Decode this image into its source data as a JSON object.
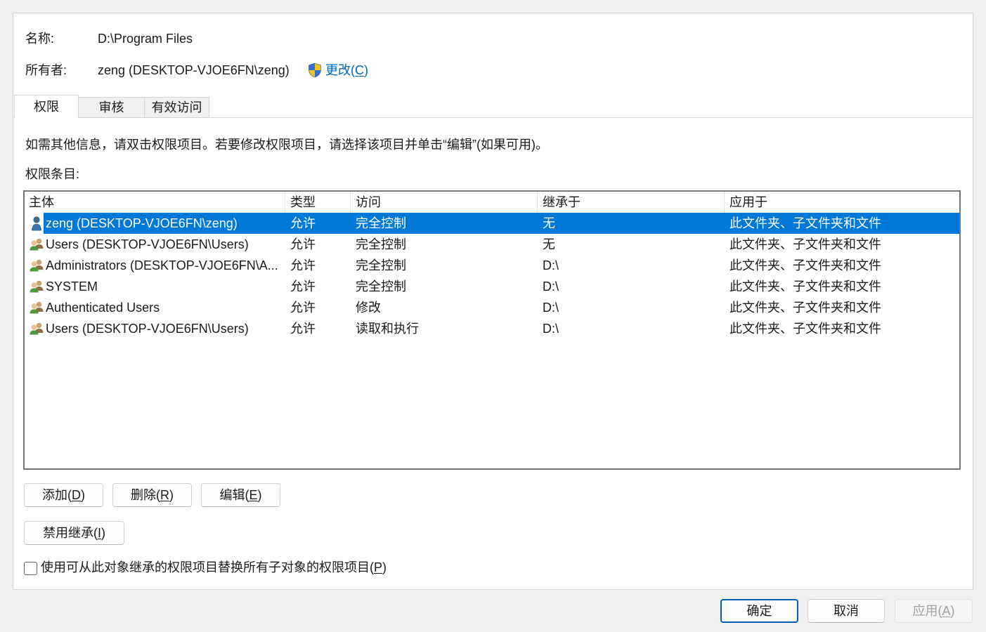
{
  "colors": {
    "selection": "#0078d7",
    "link": "#0067c0",
    "default_button_border": "#005fb8"
  },
  "header": {
    "name_label": "名称:",
    "name_value": "D:\\Program Files",
    "owner_label": "所有者:",
    "owner_value": "zeng (DESKTOP-VJOE6FN\\zeng)",
    "change_link": {
      "icon": "uac-shield-icon",
      "text": "更改(",
      "key": "C",
      "tail": ")"
    }
  },
  "tabs": [
    {
      "label": "权限",
      "selected": true
    },
    {
      "label": "审核",
      "selected": false
    },
    {
      "label": "有效访问",
      "selected": false
    }
  ],
  "permissions": {
    "info_text": "如需其他信息，请双击权限项目。若要修改权限项目，请选择该项目并单击“编辑”(如果可用)。",
    "entries_label": "权限条目:",
    "columns": [
      "主体",
      "类型",
      "访问",
      "继承于",
      "应用于"
    ],
    "rows": [
      {
        "icon": "user-icon",
        "principal": "zeng (DESKTOP-VJOE6FN\\zeng)",
        "type": "允许",
        "access": "完全控制",
        "inherited_from": "无",
        "applies_to": "此文件夹、子文件夹和文件",
        "selected": true
      },
      {
        "icon": "group-icon",
        "principal": "Users (DESKTOP-VJOE6FN\\Users)",
        "type": "允许",
        "access": "完全控制",
        "inherited_from": "无",
        "applies_to": "此文件夹、子文件夹和文件",
        "selected": false
      },
      {
        "icon": "group-icon",
        "principal": "Administrators (DESKTOP-VJOE6FN\\A...",
        "type": "允许",
        "access": "完全控制",
        "inherited_from": "D:\\",
        "applies_to": "此文件夹、子文件夹和文件",
        "selected": false
      },
      {
        "icon": "group-icon",
        "principal": "SYSTEM",
        "type": "允许",
        "access": "完全控制",
        "inherited_from": "D:\\",
        "applies_to": "此文件夹、子文件夹和文件",
        "selected": false
      },
      {
        "icon": "group-icon",
        "principal": "Authenticated Users",
        "type": "允许",
        "access": "修改",
        "inherited_from": "D:\\",
        "applies_to": "此文件夹、子文件夹和文件",
        "selected": false
      },
      {
        "icon": "group-icon",
        "principal": "Users (DESKTOP-VJOE6FN\\Users)",
        "type": "允许",
        "access": "读取和执行",
        "inherited_from": "D:\\",
        "applies_to": "此文件夹、子文件夹和文件",
        "selected": false
      }
    ]
  },
  "actions": {
    "add": {
      "text": "添加(",
      "key": "D",
      "tail": ")"
    },
    "remove": {
      "text": "删除(",
      "key": "R",
      "tail": ")"
    },
    "edit": {
      "text": "编辑(",
      "key": "E",
      "tail": ")"
    },
    "disable_inheritance": {
      "text": "禁用继承(",
      "key": "I",
      "tail": ")"
    },
    "replace_child_permissions": {
      "checked": false,
      "text": "使用可从此对象继承的权限项目替换所有子对象的权限项目(",
      "key": "P",
      "tail": ")"
    }
  },
  "footer": {
    "ok": {
      "label": "确定"
    },
    "cancel": {
      "label": "取消"
    },
    "apply": {
      "text": "应用(",
      "key": "A",
      "tail": ")",
      "disabled": true
    }
  }
}
